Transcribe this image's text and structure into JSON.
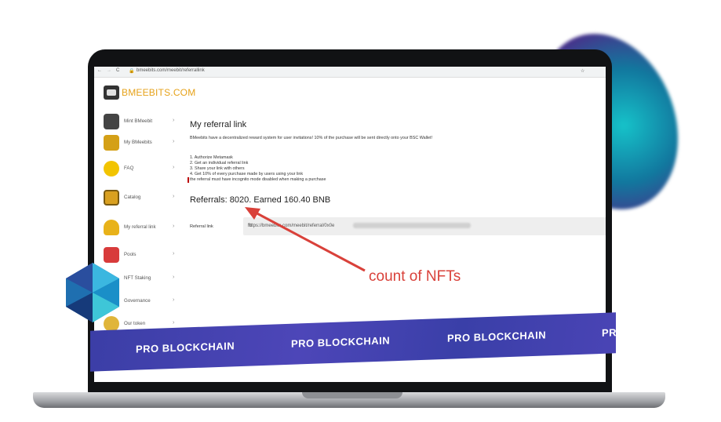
{
  "browser": {
    "url": "bmeebits.com/meebit/referrallink"
  },
  "logo": {
    "text": "BMEEBITS.COM"
  },
  "sidebar": {
    "items": [
      {
        "label": "Mint BMeebit"
      },
      {
        "label": "My BMeebits"
      },
      {
        "label": "FAQ"
      },
      {
        "label": "Catalog"
      },
      {
        "label": "My referral link"
      },
      {
        "label": "Pools"
      },
      {
        "label": "NFT Staking"
      },
      {
        "label": "Governance"
      },
      {
        "label": "Our token"
      }
    ]
  },
  "main": {
    "title": "My referral link",
    "description": "BMeebits have a decentralized reward system for user invitations! 10% of the purchase will be sent directly onto your BSC Wallet!",
    "steps": [
      "1. Authorize Metamask",
      "2. Get an individual referral link",
      "3. Share your link with others",
      "4. Get 10% of every purchase made by users using your link",
      "the referral must have incognito mode disabled when making a purchase"
    ],
    "referrals": "Referrals: 8020. Earned 160.40 BNB",
    "referral_label": "Referral link",
    "referral_value": "https://bmeebits.com/meebit/referral/0x0e",
    "referral_value_end": "fb"
  },
  "banner": {
    "texts": [
      "PRO BLOCKCHAIN",
      "PRO BLOCKCHAIN",
      "PRO BLOCKCHAIN",
      "PR"
    ]
  },
  "annotation": {
    "text": "count of NFTs",
    "color": "#d9413a"
  }
}
